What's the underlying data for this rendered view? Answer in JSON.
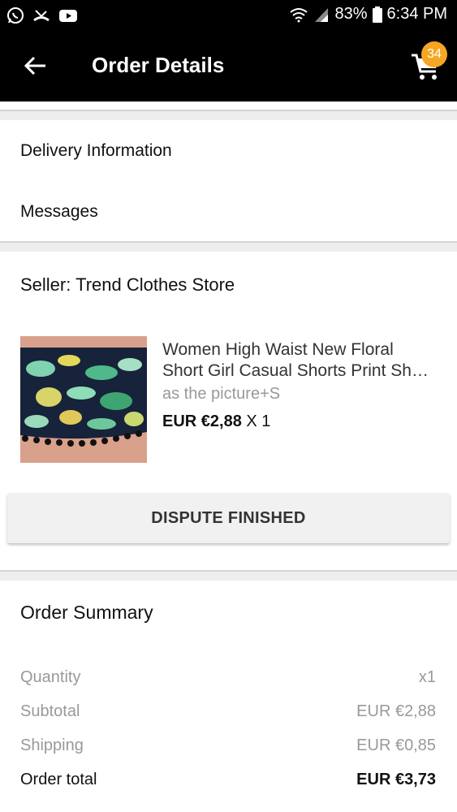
{
  "status_bar": {
    "left_icons": [
      "whatsapp-icon",
      "missed-call-icon",
      "youtube-icon"
    ],
    "battery": "83%",
    "time": "6:34 PM"
  },
  "app_bar": {
    "title": "Order Details",
    "cart_badge": "34"
  },
  "links": {
    "delivery": "Delivery Information",
    "messages": "Messages"
  },
  "seller": {
    "label": "Seller: Trend Clothes Store"
  },
  "product": {
    "title_line1": "Women High Waist New Floral",
    "title_line2": "Short Girl Casual Shorts Print Sh…",
    "variant": "as the picture+S",
    "price": "EUR €2,88",
    "quantity": "X 1"
  },
  "dispute_button": "DISPUTE FINISHED",
  "order_summary": {
    "heading": "Order Summary",
    "rows": [
      {
        "label": "Quantity",
        "value": "x1"
      },
      {
        "label": "Subtotal",
        "value": "EUR €2,88"
      },
      {
        "label": "Shipping",
        "value": "EUR €0,85"
      },
      {
        "label": "Order total",
        "value": "EUR €3,73"
      }
    ]
  },
  "colors": {
    "appbar": "#000000",
    "badge": "#f5a623",
    "background": "#eeeeee"
  }
}
